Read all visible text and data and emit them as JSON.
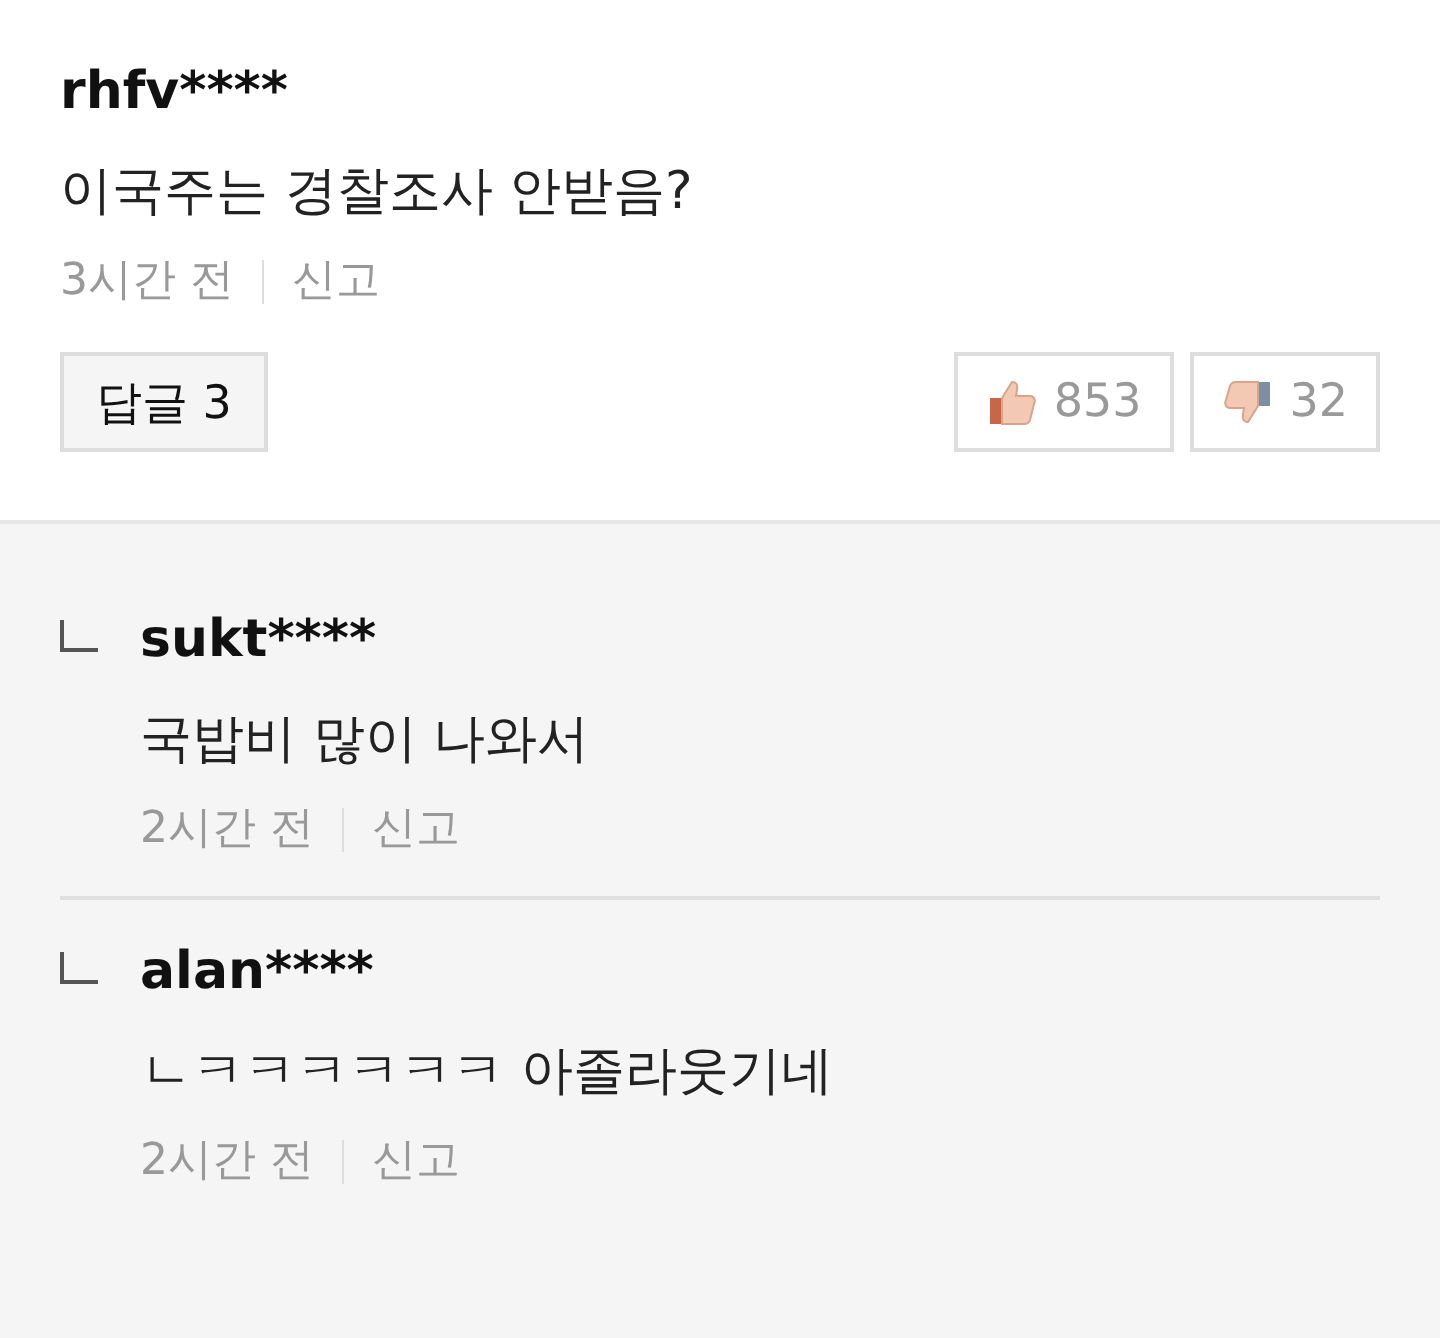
{
  "comment": {
    "author": "rhfv****",
    "text": "이국주는 경찰조사 안받음?",
    "time": "3시간 전",
    "report": "신고",
    "reply_button": "답글 3",
    "likes": "853",
    "dislikes": "32"
  },
  "replies": [
    {
      "author": "sukt****",
      "text": "국밥비 많이 나와서",
      "time": "2시간 전",
      "report": "신고"
    },
    {
      "author": "alan****",
      "text": "ㄴㅋㅋㅋㅋㅋㅋ 아졸라웃기네",
      "time": "2시간 전",
      "report": "신고"
    }
  ]
}
